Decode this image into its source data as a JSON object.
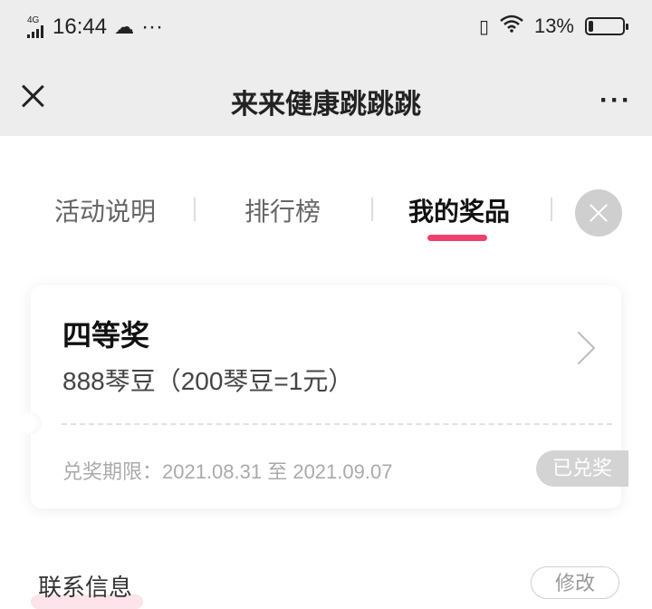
{
  "status_bar": {
    "network": "4G",
    "time": "16:44",
    "more": "···",
    "battery": "13%",
    "battery_level": 0.13
  },
  "header": {
    "title": "来来健康跳跳跳",
    "more": "···"
  },
  "tabs": [
    {
      "label": "活动说明",
      "active": false
    },
    {
      "label": "排行榜",
      "active": false
    },
    {
      "label": "我的奖品",
      "active": true
    }
  ],
  "prize": {
    "name": "四等奖",
    "description": "888琴豆（200琴豆=1元）",
    "validity": "兑奖期限：2021.08.31 至 2021.09.07",
    "status": "已兑奖"
  },
  "contact": {
    "label": "联系信息",
    "edit_label": "修改"
  },
  "colors": {
    "accent": "#f0406d",
    "header_bg": "#ededed"
  }
}
